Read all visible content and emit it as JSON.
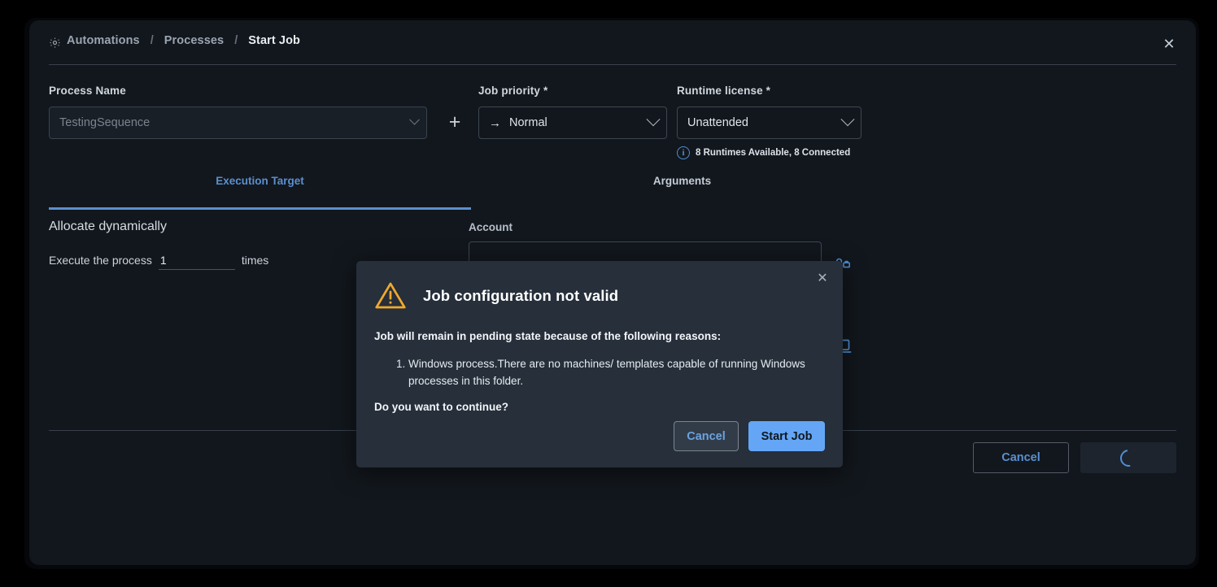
{
  "breadcrumb": {
    "icon": "gear-automation-icon",
    "items": [
      "Automations",
      "Processes",
      "Start Job"
    ],
    "separator": "/"
  },
  "window": {
    "close_label": "✕"
  },
  "form": {
    "process": {
      "label": "Process Name",
      "value": "TestingSequence",
      "add_button": "+"
    },
    "priority": {
      "label": "Job priority *",
      "value": "Normal",
      "arrow": "→"
    },
    "license": {
      "label": "Runtime license *",
      "value": "Unattended",
      "note": "8 Runtimes Available, 8 Connected",
      "note_icon": "i"
    }
  },
  "tabs": [
    {
      "label": "Execution Target",
      "active": true
    },
    {
      "label": "Arguments",
      "active": false
    }
  ],
  "execution_target": {
    "allocate_title": "Allocate dynamically",
    "execute_prefix": "Execute the process",
    "execute_count": "1",
    "execute_suffix": "times",
    "account_label": "Account"
  },
  "footer": {
    "cancel_label": "Cancel"
  },
  "modal": {
    "title": "Job configuration not valid",
    "subtitle": "Job will remain in pending state because of the following reasons:",
    "reasons": [
      "Windows process.There are no machines/ templates capable of running Windows processes in this folder."
    ],
    "question": "Do you want to continue?",
    "cancel_label": "Cancel",
    "confirm_label": "Start Job",
    "close_label": "✕"
  },
  "colors": {
    "accent_blue": "#5b8fce",
    "primary_button": "#64a6f5",
    "warning": "#f0a92e",
    "panel_bg": "#12171d",
    "modal_bg": "#262f3a"
  }
}
